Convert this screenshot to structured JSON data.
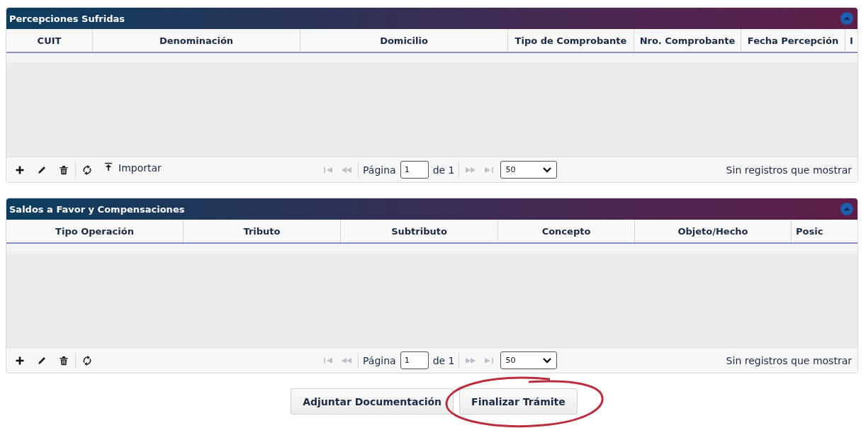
{
  "panels": [
    {
      "title": "Percepciones Sufridas",
      "expanded": true,
      "columns": [
        "CUIT",
        "Denominación",
        "Domicilio",
        "Tipo de Comprobante",
        "Nro. Comprobante",
        "Fecha Percepción",
        "I"
      ],
      "tools": [
        {
          "kind": "add"
        },
        {
          "kind": "edit"
        },
        {
          "kind": "delete"
        },
        {
          "kind": "separator"
        },
        {
          "kind": "refresh"
        },
        {
          "kind": "import",
          "label": "Importar"
        }
      ],
      "pager": {
        "nav_disabled": true,
        "page_label": "Página",
        "page": "1",
        "of": "de 1",
        "page_size": "50"
      },
      "status": "Sin registros que mostrar"
    },
    {
      "title": "Saldos a Favor y Compensaciones",
      "expanded": true,
      "columns": [
        "Tipo Operación",
        "Tributo",
        "Subtributo",
        "Concepto",
        "Objeto/Hecho",
        "Posic"
      ],
      "tools": [
        {
          "kind": "add"
        },
        {
          "kind": "edit"
        },
        {
          "kind": "delete"
        },
        {
          "kind": "separator"
        },
        {
          "kind": "refresh"
        }
      ],
      "pager": {
        "nav_disabled": true,
        "page_label": "Página",
        "page": "1",
        "of": "de 1",
        "page_size": "50"
      },
      "status": "Sin registros que mostrar"
    }
  ],
  "buttons": [
    {
      "label": "Adjuntar Documentación",
      "circled": false
    },
    {
      "label": "Finalizar Trámite",
      "circled": true
    }
  ]
}
